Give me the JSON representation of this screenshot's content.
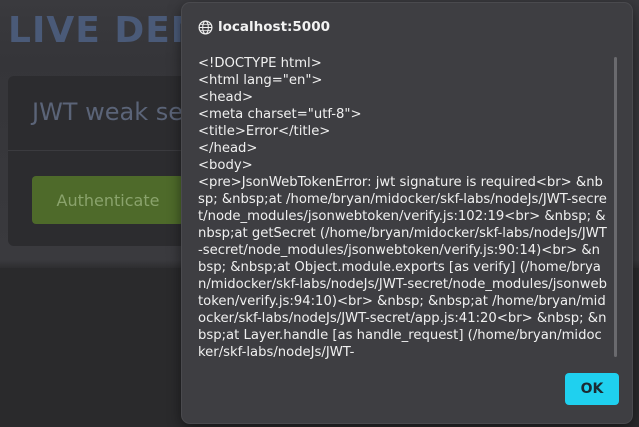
{
  "page": {
    "title": "LIVE DEM",
    "card_title": "JWT weak se",
    "authenticate_label": "Authenticate"
  },
  "dialog": {
    "origin": "localhost:5000",
    "message": "<!DOCTYPE html>\n<html lang=\"en\">\n<head>\n<meta charset=\"utf-8\">\n<title>Error</title>\n</head>\n<body>\n<pre>JsonWebTokenError: jwt signature is required<br> &nbsp; &nbsp;at /home/bryan/midocker/skf-labs/nodeJs/JWT-secret/node_modules/jsonwebtoken/verify.js:102:19<br> &nbsp; &nbsp;at getSecret (/home/bryan/midocker/skf-labs/nodeJs/JWT-secret/node_modules/jsonwebtoken/verify.js:90:14)<br> &nbsp; &nbsp;at Object.module.exports [as verify] (/home/bryan/midocker/skf-labs/nodeJs/JWT-secret/node_modules/jsonwebtoken/verify.js:94:10)<br> &nbsp; &nbsp;at /home/bryan/midocker/skf-labs/nodeJs/JWT-secret/app.js:41:20<br> &nbsp; &nbsp;at Layer.handle [as handle_request] (/home/bryan/midocker/skf-labs/nodeJs/JWT-",
    "ok_label": "OK"
  },
  "colors": {
    "dialog_bg": "#3e3e42",
    "ok_button": "#1fd0ef",
    "authenticate_button": "#4e6a2a"
  },
  "icons": {
    "origin": "globe-icon"
  }
}
